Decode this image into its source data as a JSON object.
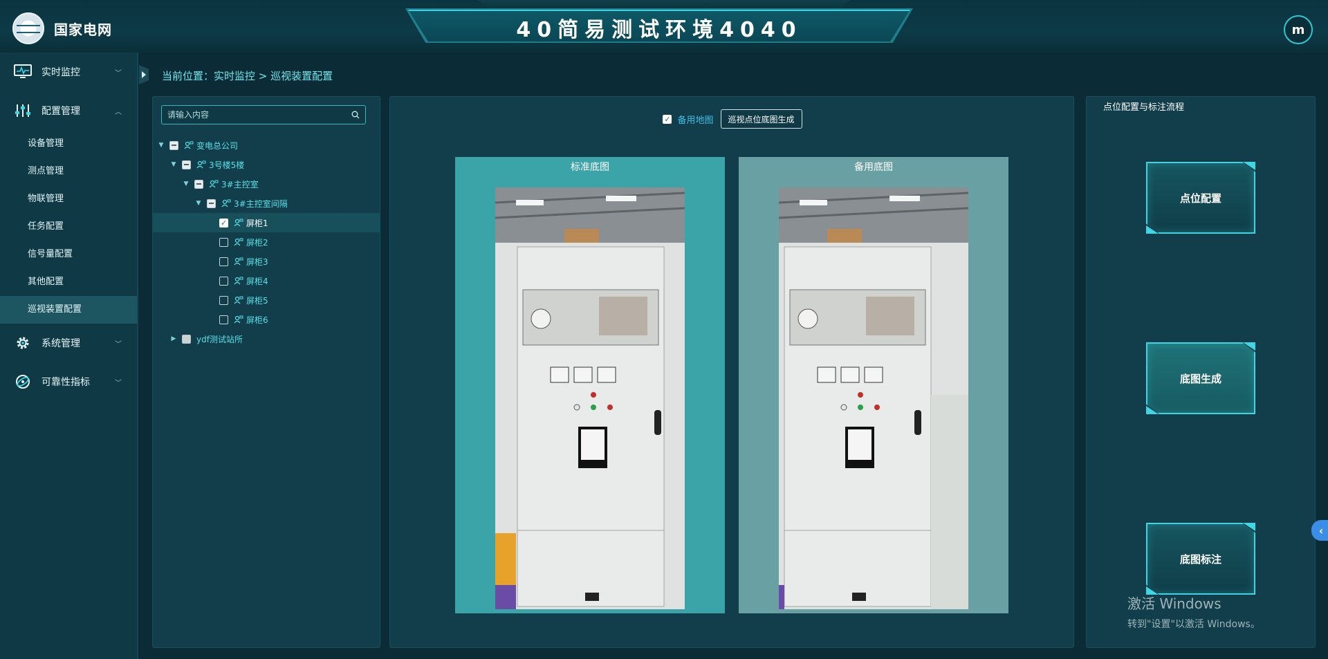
{
  "header": {
    "brand": "国家电网",
    "title": "40简易测试环境4040",
    "user_initial": "m"
  },
  "sidebar": {
    "groups": [
      {
        "label": "实时监控",
        "icon": "monitor-icon",
        "expanded": false
      },
      {
        "label": "配置管理",
        "icon": "sliders-icon",
        "expanded": true,
        "items": [
          "设备管理",
          "测点管理",
          "物联管理",
          "任务配置",
          "信号量配置",
          "其他配置",
          "巡视装置配置"
        ],
        "active": "巡视装置配置"
      },
      {
        "label": "系统管理",
        "icon": "gear-icon",
        "expanded": false
      },
      {
        "label": "可靠性指标",
        "icon": "orbit-icon",
        "expanded": false
      }
    ]
  },
  "breadcrumb": {
    "text": "当前位置：实时监控 > 巡视装置配置"
  },
  "tree": {
    "search_placeholder": "请输入内容",
    "nodes": [
      {
        "label": "变电总公司",
        "level": 0,
        "toggle": "expanded",
        "check": "indeterminate"
      },
      {
        "label": "3号楼5楼",
        "level": 1,
        "toggle": "expanded",
        "check": "indeterminate"
      },
      {
        "label": "3#主控室",
        "level": 2,
        "toggle": "expanded",
        "check": "indeterminate"
      },
      {
        "label": "3#主控室间隔",
        "level": 3,
        "toggle": "expanded",
        "check": "indeterminate"
      },
      {
        "label": "屏柜1",
        "level": 4,
        "toggle": "none",
        "check": "checked",
        "selected": true
      },
      {
        "label": "屏柜2",
        "level": 4,
        "toggle": "none",
        "check": "unchecked"
      },
      {
        "label": "屏柜3",
        "level": 4,
        "toggle": "none",
        "check": "unchecked"
      },
      {
        "label": "屏柜4",
        "level": 4,
        "toggle": "none",
        "check": "unchecked"
      },
      {
        "label": "屏柜5",
        "level": 4,
        "toggle": "none",
        "check": "unchecked"
      },
      {
        "label": "屏柜6",
        "level": 4,
        "toggle": "none",
        "check": "unchecked"
      },
      {
        "label": "ydf测试站所",
        "level": 1,
        "toggle": "collapsed",
        "check": "unchecked-gray"
      }
    ]
  },
  "middle": {
    "backup_map_checkbox_label": "备用地图",
    "backup_map_checked": true,
    "generate_button": "巡视点位底图生成",
    "standard_map_title": "标准底图",
    "backup_map_title": "备用底图"
  },
  "right": {
    "title": "点位配置与标注流程",
    "buttons": [
      "点位配置",
      "底图生成",
      "底图标注"
    ]
  },
  "watermark": {
    "line1": "激活 Windows",
    "line2": "转到\"设置\"以激活 Windows。"
  },
  "colors": {
    "background": "#0b2c36",
    "panel": "#113e4a",
    "accent": "#3fd5e3",
    "tree_text": "#59e0e9"
  }
}
